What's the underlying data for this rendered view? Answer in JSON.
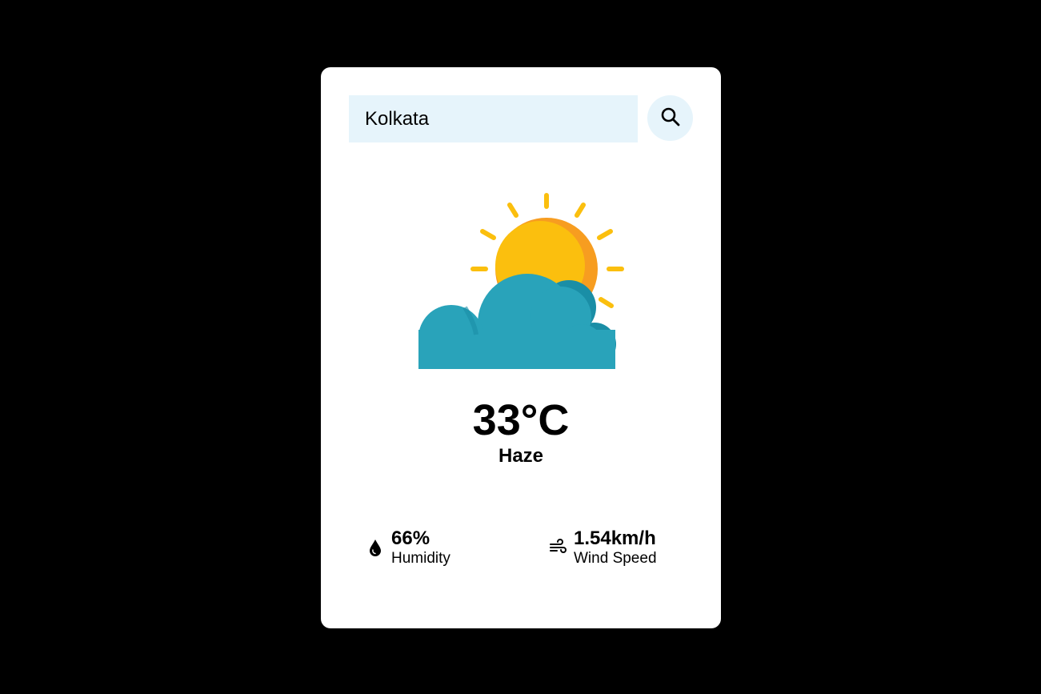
{
  "search": {
    "value": "Kolkata",
    "button_icon": "search-icon"
  },
  "weather": {
    "icon": "sun-behind-cloud-icon",
    "temperature": "33°C",
    "condition": "Haze"
  },
  "stats": {
    "humidity": {
      "icon": "water-drop-icon",
      "value": "66%",
      "label": "Humidity"
    },
    "wind": {
      "icon": "wind-icon",
      "value": "1.54km/h",
      "label": "Wind Speed"
    }
  },
  "colors": {
    "background": "#000000",
    "card": "#ffffff",
    "input_background": "#e6f4fb",
    "sun": "#fbbf0e",
    "sun_shade": "#f79d20",
    "cloud": "#29a3ba",
    "cloud_shade": "#1a8ea6"
  }
}
